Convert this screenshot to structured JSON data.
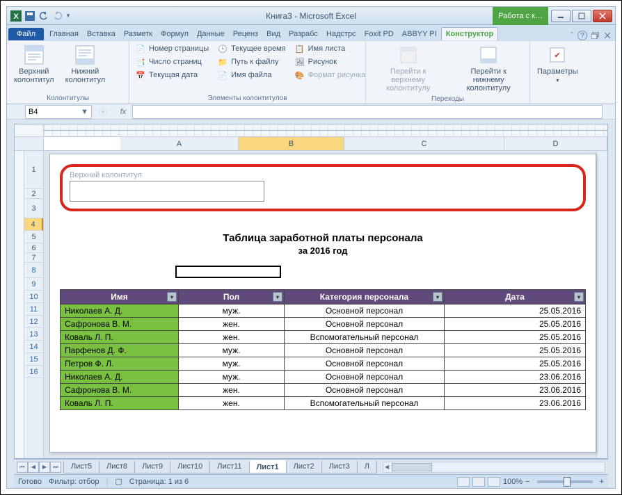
{
  "title": "Книга3 - Microsoft Excel",
  "tool_context": "Работа с к…",
  "tabs": {
    "file": "Файл",
    "items": [
      "Главная",
      "Вставка",
      "Разметк",
      "Формул",
      "Данные",
      "Реценз",
      "Вид",
      "Разрабс",
      "Надстрс",
      "Foxit PD",
      "ABBYY PI"
    ],
    "active": "Конструктор"
  },
  "ribbon": {
    "g1": {
      "btn1": "Верхний\nколонтитул",
      "btn2": "Нижний\nколонтитул",
      "label": "Колонтитулы"
    },
    "g2": {
      "c1": [
        "Номер страницы",
        "Число страниц",
        "Текущая дата"
      ],
      "c2": [
        "Текущее время",
        "Путь к файлу",
        "Имя файла"
      ],
      "c3": [
        "Имя листа",
        "Рисунок",
        "Формат рисунка"
      ],
      "label": "Элементы колонтитулов"
    },
    "g3": {
      "btn1": "Перейти к верхнему\nколонтитулу",
      "btn2": "Перейти к нижнему\nколонтитулу",
      "label": "Переходы"
    },
    "g4": {
      "btn": "Параметры",
      "label": ""
    }
  },
  "namebox": "B4",
  "fx": "fx",
  "cols": [
    "A",
    "B",
    "C",
    "D"
  ],
  "rows": [
    "1",
    "2",
    "3",
    "4",
    "5",
    "6",
    "7",
    "8",
    "9",
    "10",
    "11",
    "12",
    "13",
    "14",
    "15",
    "16"
  ],
  "header_hint": "Верхний колонтитул",
  "sheet_title": "Таблица заработной платы персонала",
  "sheet_sub": "за 2016 год",
  "thead": [
    "Имя",
    "Пол",
    "Категория персонала",
    "Дата"
  ],
  "tdata": [
    [
      "Николаев А. Д.",
      "муж.",
      "Основной персонал",
      "25.05.2016"
    ],
    [
      "Сафронова В. М.",
      "жен.",
      "Основной персонал",
      "25.05.2016"
    ],
    [
      "Коваль Л. П.",
      "жен.",
      "Вспомогательный персонал",
      "25.05.2016"
    ],
    [
      "Парфенов Д. Ф.",
      "муж.",
      "Основной персонал",
      "25.05.2016"
    ],
    [
      "Петров Ф. Л.",
      "муж.",
      "Основной персонал",
      "25.05.2016"
    ],
    [
      "Николаев А. Д.",
      "муж.",
      "Основной персонал",
      "23.06.2016"
    ],
    [
      "Сафронова В. М.",
      "жен.",
      "Основной персонал",
      "23.06.2016"
    ],
    [
      "Коваль Л. П.",
      "жен.",
      "Вспомогательный персонал",
      "23.06.2016"
    ]
  ],
  "sheets": [
    "Лист5",
    "Лист8",
    "Лист9",
    "Лист10",
    "Лист11",
    "Лист1",
    "Лист2",
    "Лист3",
    "Л"
  ],
  "active_sheet": "Лист1",
  "status": {
    "ready": "Готово",
    "filter": "Фильтр: отбор",
    "page": "Страница: 1 из 6",
    "zoom": "100%"
  },
  "zoom_minus": "−",
  "zoom_plus": "+"
}
